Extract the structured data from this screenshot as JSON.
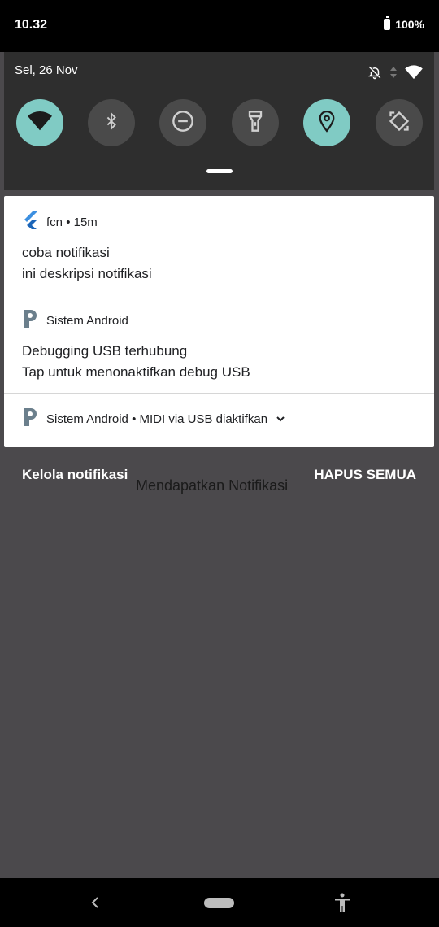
{
  "status_bar": {
    "time": "10.32",
    "battery": "100%"
  },
  "quick_settings": {
    "date": "Sel, 26 Nov",
    "tiles": [
      {
        "icon": "wifi-icon",
        "state": "on"
      },
      {
        "icon": "bluetooth-icon",
        "state": "off"
      },
      {
        "icon": "do-not-disturb-icon",
        "state": "off"
      },
      {
        "icon": "flashlight-icon",
        "state": "off"
      },
      {
        "icon": "location-icon",
        "state": "on"
      },
      {
        "icon": "auto-rotate-icon",
        "state": "off"
      }
    ],
    "accent_color": "#80cbc4"
  },
  "notifications": {
    "n1": {
      "app": "fcn",
      "time": "15m",
      "title": "coba notifikasi",
      "body": "ini deskripsi notifikasi",
      "icon": "flutter-icon"
    },
    "n2": {
      "app": "Sistem Android",
      "title": "Debugging USB terhubung",
      "body": "Tap untuk menonaktifkan debug USB",
      "icon": "android-system-icon"
    },
    "n3": {
      "app": "Sistem Android",
      "summary": "MIDI via USB diaktifkan",
      "icon": "android-system-icon"
    }
  },
  "actions": {
    "manage": "Kelola notifikasi",
    "clear_all": "HAPUS SEMUA"
  },
  "app_content": {
    "text": "Mendapatkan Notifikasi"
  },
  "nav": {
    "back": "back-icon",
    "home": "home-pill",
    "accessibility": "accessibility-icon"
  }
}
